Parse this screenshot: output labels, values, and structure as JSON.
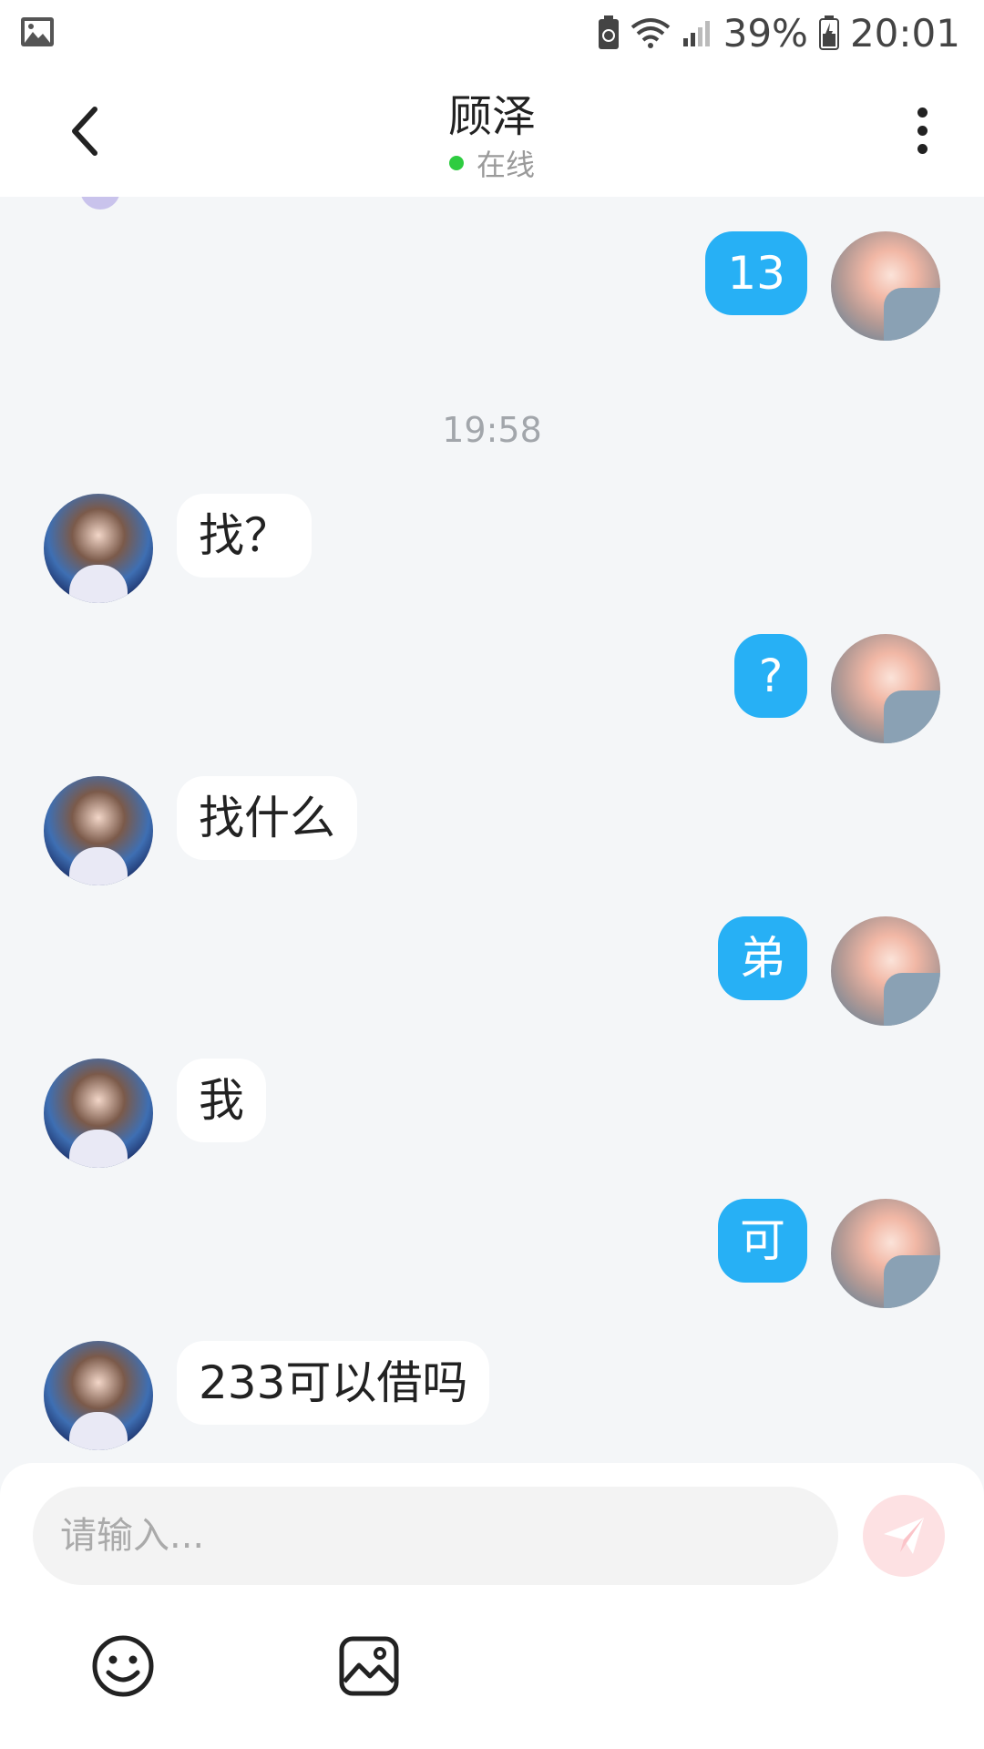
{
  "status_bar": {
    "battery_percent": "39%",
    "time": "20:01",
    "icons": [
      "gallery-icon",
      "battery-saver-icon",
      "wifi-icon",
      "signal-icon",
      "battery-icon"
    ]
  },
  "header": {
    "title": "顾泽",
    "status": "在线",
    "status_color": "#2ecc40"
  },
  "chat": {
    "timestamp": "19:58",
    "messages": [
      {
        "from": "me",
        "text": "13"
      },
      {
        "from": "him",
        "text": "找？"
      },
      {
        "from": "me",
        "text": "?"
      },
      {
        "from": "him",
        "text": "找什么"
      },
      {
        "from": "me",
        "text": "弟"
      },
      {
        "from": "him",
        "text": "我"
      },
      {
        "from": "me",
        "text": "可"
      },
      {
        "from": "him",
        "text": "233可以借吗"
      }
    ],
    "accent_color": "#27b0f5"
  },
  "composer": {
    "placeholder": "请输入...",
    "send_icon": "send-icon",
    "tools": [
      "emoji-icon",
      "image-icon"
    ]
  }
}
